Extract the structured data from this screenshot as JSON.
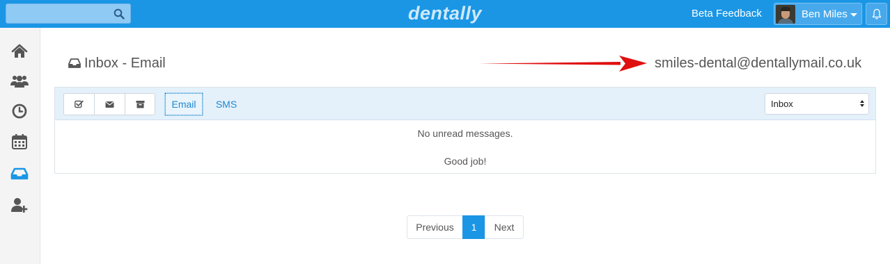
{
  "header": {
    "brand": "dentally",
    "search_placeholder": "",
    "beta_feedback": "Beta Feedback",
    "user_name": "Ben Miles"
  },
  "sidebar": {
    "items": [
      {
        "icon": "home-icon"
      },
      {
        "icon": "patients-icon"
      },
      {
        "icon": "clock-icon"
      },
      {
        "icon": "calendar-icon"
      },
      {
        "icon": "inbox-icon",
        "active": true
      },
      {
        "icon": "add-user-icon"
      }
    ]
  },
  "page": {
    "title": "Inbox - Email",
    "email_address": "smiles-dental@dentallymail.co.uk"
  },
  "toolbar": {
    "tabs": [
      "Email",
      "SMS"
    ],
    "active_tab": "Email",
    "folder_select": "Inbox"
  },
  "messages": {
    "empty_line1": "No unread messages.",
    "empty_line2": "Good job!"
  },
  "pagination": {
    "previous": "Previous",
    "current": "1",
    "next": "Next"
  },
  "colors": {
    "accent": "#1a96e5",
    "arrow": "#e01010"
  }
}
